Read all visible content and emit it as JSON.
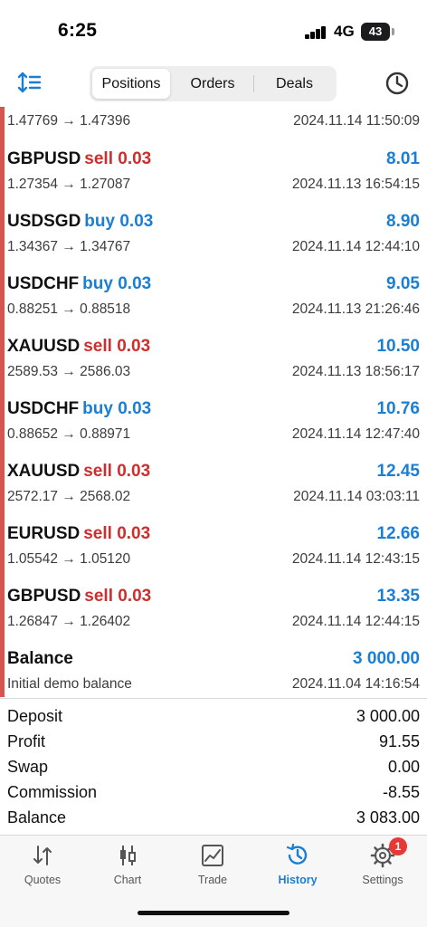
{
  "status_bar": {
    "time": "6:25",
    "network": "4G",
    "battery": "43"
  },
  "toolbar": {
    "tabs": [
      {
        "label": "Positions",
        "active": true
      },
      {
        "label": "Orders",
        "active": false
      },
      {
        "label": "Deals",
        "active": false
      }
    ],
    "left_icon": "sort-icon",
    "right_icon": "clock-icon"
  },
  "colors": {
    "sell": "#cf2e2e",
    "buy": "#1a7fd4",
    "profit": "#1a7fd4",
    "accent_bar": "#d9534f"
  },
  "deals": [
    {
      "symbol": "",
      "side": "",
      "side_class": "",
      "profit": "",
      "prices": "1.47769 → 1.47396",
      "time": "2024.11.14 11:50:09"
    },
    {
      "symbol": "GBPUSD",
      "side": "sell 0.03",
      "side_class": "sell",
      "profit": "8.01",
      "prices": "1.27354 → 1.27087",
      "time": "2024.11.13 16:54:15"
    },
    {
      "symbol": "USDSGD",
      "side": "buy 0.03",
      "side_class": "buy",
      "profit": "8.90",
      "prices": "1.34367 → 1.34767",
      "time": "2024.11.14 12:44:10"
    },
    {
      "symbol": "USDCHF",
      "side": "buy 0.03",
      "side_class": "buy",
      "profit": "9.05",
      "prices": "0.88251 → 0.88518",
      "time": "2024.11.13 21:26:46"
    },
    {
      "symbol": "XAUUSD",
      "side": "sell 0.03",
      "side_class": "sell",
      "profit": "10.50",
      "prices": "2589.53 → 2586.03",
      "time": "2024.11.13 18:56:17"
    },
    {
      "symbol": "USDCHF",
      "side": "buy 0.03",
      "side_class": "buy",
      "profit": "10.76",
      "prices": "0.88652 → 0.88971",
      "time": "2024.11.14 12:47:40"
    },
    {
      "symbol": "XAUUSD",
      "side": "sell 0.03",
      "side_class": "sell",
      "profit": "12.45",
      "prices": "2572.17 → 2568.02",
      "time": "2024.11.14 03:03:11"
    },
    {
      "symbol": "EURUSD",
      "side": "sell 0.03",
      "side_class": "sell",
      "profit": "12.66",
      "prices": "1.05542 → 1.05120",
      "time": "2024.11.14 12:43:15"
    },
    {
      "symbol": "GBPUSD",
      "side": "sell 0.03",
      "side_class": "sell",
      "profit": "13.35",
      "prices": "1.26847 → 1.26402",
      "time": "2024.11.14 12:44:15"
    },
    {
      "symbol": "Balance",
      "side": "",
      "side_class": "",
      "profit": "3 000.00",
      "prices": "Initial demo balance",
      "time": "2024.11.04 14:16:54"
    }
  ],
  "summary": [
    {
      "label": "Deposit",
      "value": "3 000.00"
    },
    {
      "label": "Profit",
      "value": "91.55"
    },
    {
      "label": "Swap",
      "value": "0.00"
    },
    {
      "label": "Commission",
      "value": "-8.55"
    },
    {
      "label": "Balance",
      "value": "3 083.00"
    }
  ],
  "tab_bar": [
    {
      "label": "Quotes",
      "icon": "quotes-icon",
      "active": false
    },
    {
      "label": "Chart",
      "icon": "candlestick-chart-icon",
      "active": false
    },
    {
      "label": "Trade",
      "icon": "trade-chart-icon",
      "active": false
    },
    {
      "label": "History",
      "icon": "history-icon",
      "active": true
    },
    {
      "label": "Settings",
      "icon": "gear-icon",
      "active": false,
      "badge": "1"
    }
  ]
}
